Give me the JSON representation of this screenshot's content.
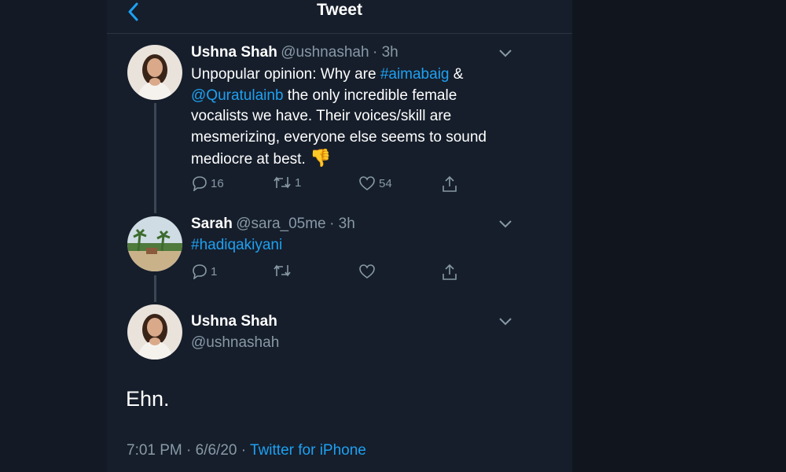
{
  "header": {
    "title": "Tweet"
  },
  "tweets": [
    {
      "name": "Ushna Shah",
      "handle": "@ushnashah",
      "time": "· 3h",
      "text_parts": {
        "p1": "Unpopular opinion: Why are ",
        "link1": "#aimabaig",
        "p2": " & ",
        "link2": "@Quratulainb",
        "p3": " the only incredible female vocalists we have. Their voices/skill are mesmerizing, everyone else seems to sound mediocre at best. ",
        "emoji": "👎"
      },
      "replies": "16",
      "retweets": "1",
      "likes": "54"
    },
    {
      "name": "Sarah",
      "handle": "@sara_05me",
      "time": "· 3h",
      "text": "#hadiqakiyani",
      "replies": "1",
      "retweets": "",
      "likes": ""
    }
  ],
  "main_tweet": {
    "name": "Ushna Shah",
    "handle": "@ushnashah",
    "text": "Ehn.",
    "timestamp": "7:01 PM · 6/6/20 · ",
    "source": "Twitter for iPhone"
  },
  "colors": {
    "accent": "#1da1f2",
    "muted": "#8899a6",
    "background": "#161e2b"
  },
  "icons": [
    "back-chevron-icon",
    "chevron-down-icon",
    "reply-icon",
    "retweet-icon",
    "like-icon",
    "share-icon"
  ]
}
